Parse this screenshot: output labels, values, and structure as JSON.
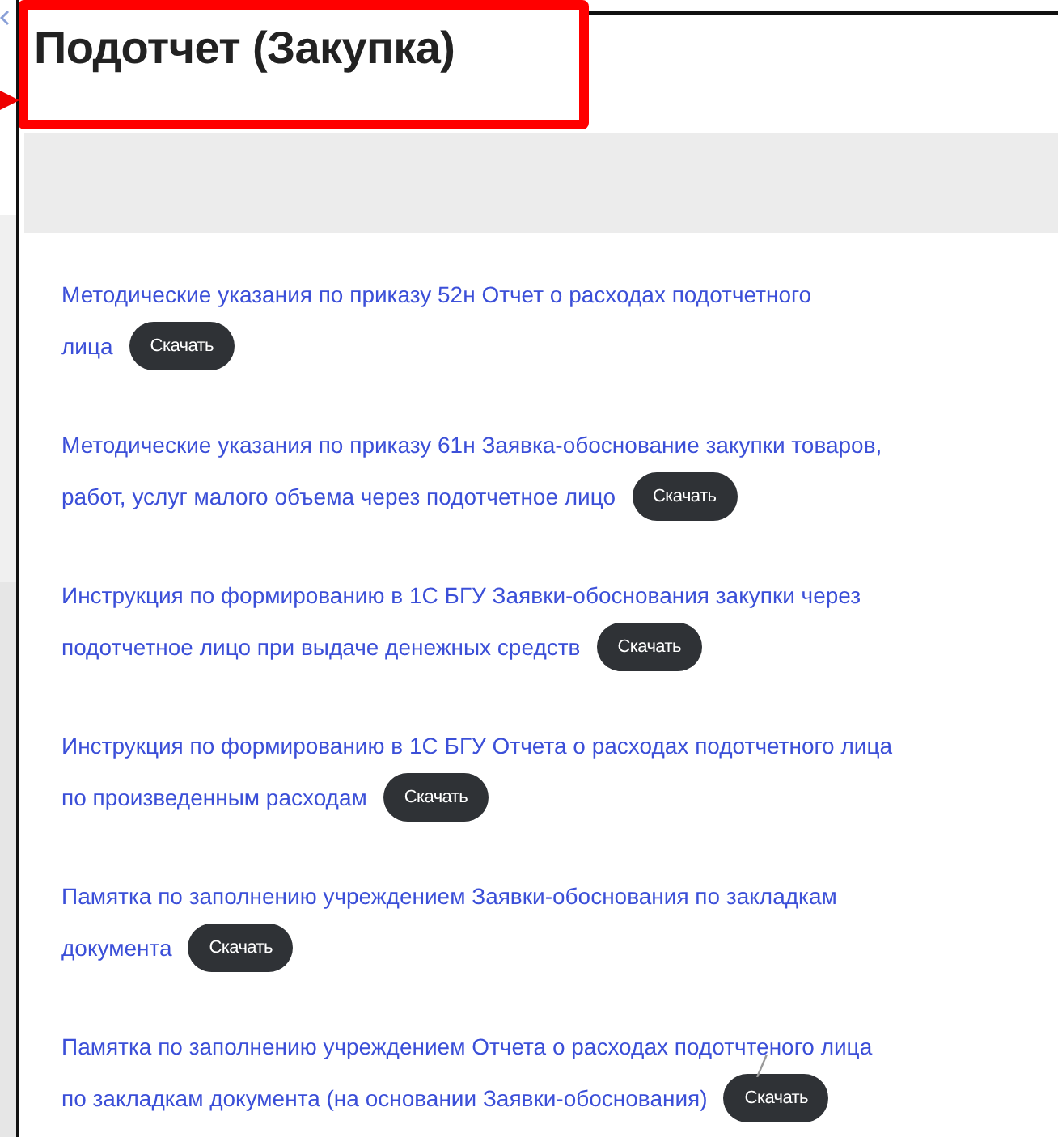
{
  "page": {
    "title": "Подотчет (Закупка)"
  },
  "documents": [
    {
      "lines": [
        "Методические указания по приказу 52н Отчет о расходах подотчетного",
        "лица"
      ],
      "button": "Скачать"
    },
    {
      "lines": [
        "Методические указания по приказу 61н Заявка-обоснование закупки товаров,",
        "работ, услуг малого объема через подотчетное лицо"
      ],
      "button": "Скачать"
    },
    {
      "lines": [
        "Инструкция по формированию в 1С БГУ Заявки-обоснования закупки через",
        "подотчетное лицо при выдаче денежных средств"
      ],
      "button": "Скачать"
    },
    {
      "lines": [
        "Инструкция по формированию в 1С БГУ Отчета о расходах подотчетного лица",
        "по произведенным расходам"
      ],
      "button": "Скачать"
    },
    {
      "lines": [
        "Памятка по заполнению учреждением Заявки-обоснования по закладкам",
        "документа"
      ],
      "button": "Скачать"
    },
    {
      "lines": [
        "Памятка по заполнению учреждением Отчета о расходах подотчтеного лица",
        "по закладкам документа (на основании Заявки-обоснования)"
      ],
      "button": "Скачать"
    }
  ]
}
